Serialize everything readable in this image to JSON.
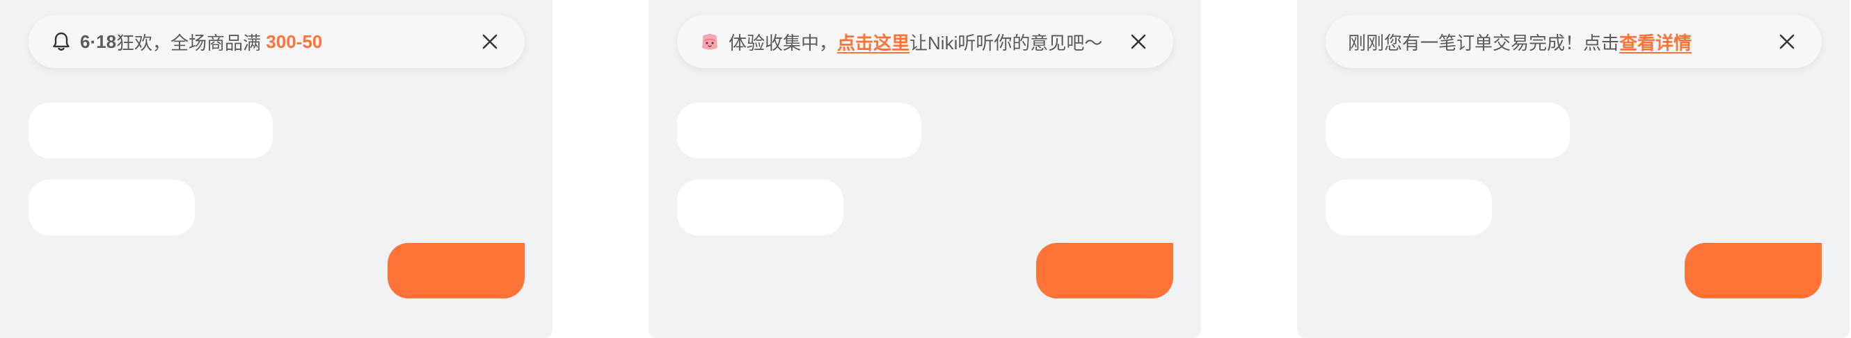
{
  "colors": {
    "panel_bg": "#f1f2f4",
    "notice_bg": "#f7f7f8",
    "accent": "#ff7436",
    "text": "#5b5b5b",
    "bubble_in": "#ffffff",
    "bubble_out": "#ff7436"
  },
  "notices": [
    {
      "icon": "bell-icon",
      "prefix_bold": "6·18",
      "text": "狂欢，全场商品满 ",
      "highlight": "300-50",
      "close_icon": "close-icon"
    },
    {
      "icon": "cartoon-avatar-icon",
      "text": "体验收集中，",
      "link": "点击这里",
      "suffix": "让Niki听听你的意见吧〜",
      "close_icon": "close-icon"
    },
    {
      "text": "刚刚您有一笔订单交易完成！点击",
      "link": "查看详情",
      "close_icon": "close-icon"
    }
  ]
}
